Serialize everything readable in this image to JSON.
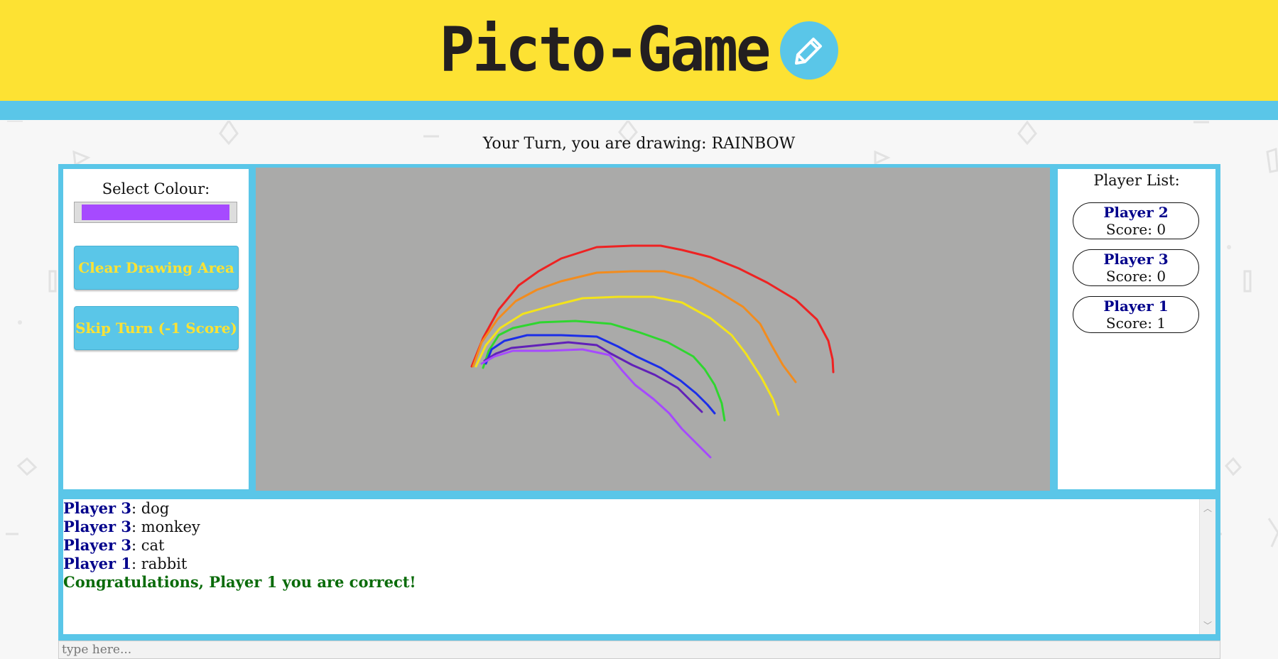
{
  "app": {
    "title": "Picto-Game"
  },
  "turn": {
    "message": "Your Turn, you are drawing: RAINBOW"
  },
  "tools": {
    "select_colour_label": "Select Colour:",
    "selected_colour": "#a64aff",
    "clear_button": "Clear Drawing Area",
    "skip_button": "Skip Turn (-1 Score)"
  },
  "canvas": {
    "background": "#aaaaa9",
    "stroke_colors": [
      "#ee2222",
      "#f28c1e",
      "#f3e31b",
      "#2fd62f",
      "#1c2ee8",
      "#6121b8",
      "#a64aff"
    ]
  },
  "players": {
    "label": "Player List:",
    "list": [
      {
        "name": "Player 2",
        "score": "Score: 0"
      },
      {
        "name": "Player 3",
        "score": "Score: 0"
      },
      {
        "name": "Player 1",
        "score": "Score: 1"
      }
    ]
  },
  "chat": {
    "messages": [
      {
        "name": "Player 3",
        "text": ": dog"
      },
      {
        "name": "Player 3",
        "text": ": monkey"
      },
      {
        "name": "Player 3",
        "text": ": cat"
      },
      {
        "name": "Player 1",
        "text": ": rabbit"
      }
    ],
    "success": "Congratulations, Player 1 you are correct!",
    "input_placeholder": "type here..."
  },
  "colors": {
    "header": "#fde233",
    "accent": "#5ac6e8",
    "player_name": "#00008b",
    "success": "#0a6b0a"
  }
}
